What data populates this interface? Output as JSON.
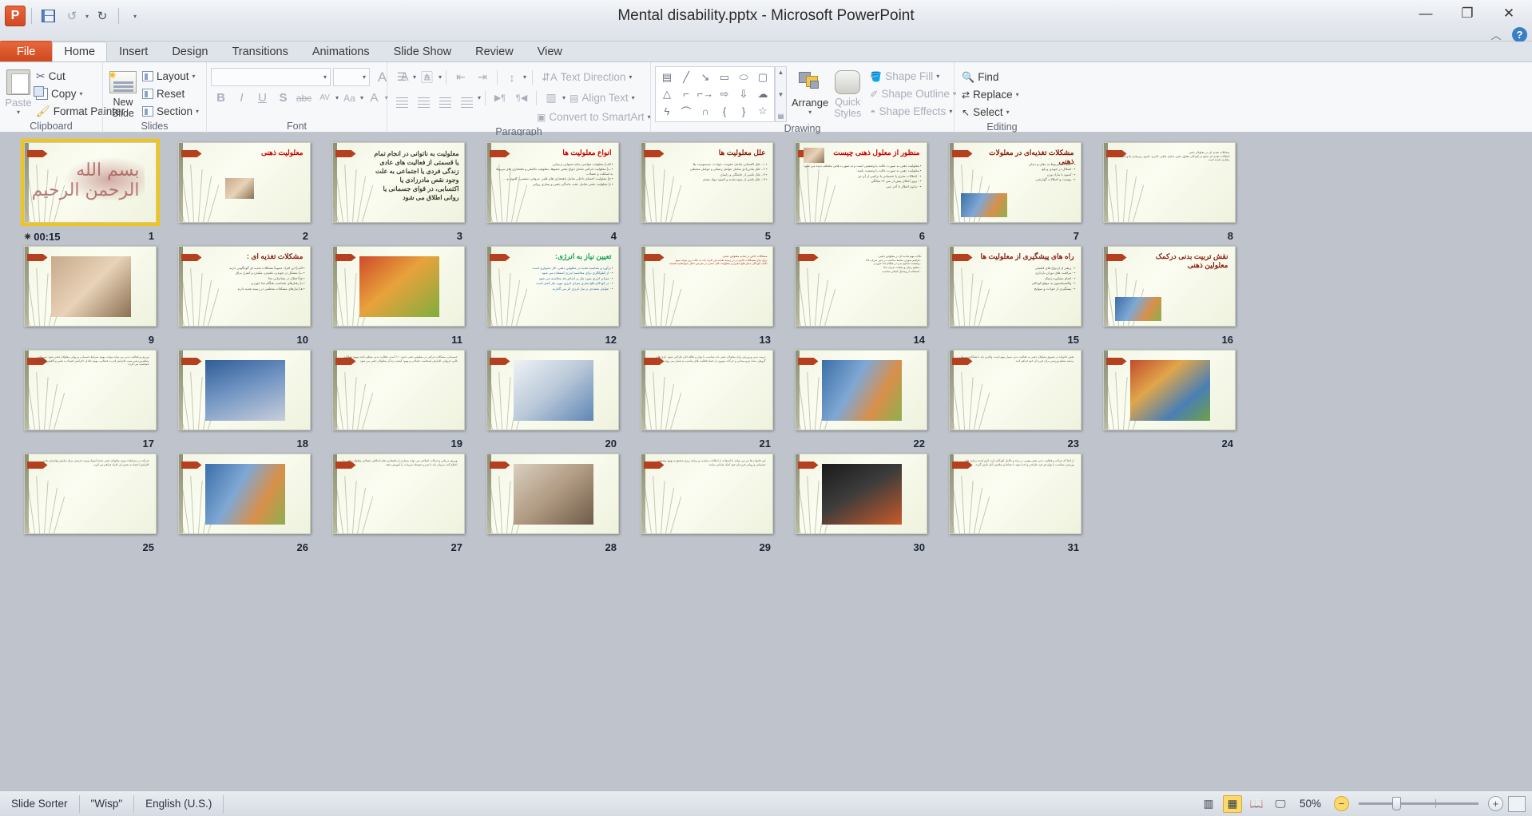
{
  "window": {
    "title": "Mental disability.pptx  -  Microsoft PowerPoint",
    "minimize": "—",
    "restore": "❐",
    "close": "✕",
    "collapse_ribbon": "︿",
    "help": "?"
  },
  "quick_access": {
    "app_icon": "P",
    "save": "save-icon",
    "undo": "↺",
    "undo_caret": "▾",
    "redo": "↻",
    "customize": "▾"
  },
  "tabs": [
    {
      "label": "File",
      "active": false,
      "file": true
    },
    {
      "label": "Home",
      "active": true
    },
    {
      "label": "Insert",
      "active": false
    },
    {
      "label": "Design",
      "active": false
    },
    {
      "label": "Transitions",
      "active": false
    },
    {
      "label": "Animations",
      "active": false
    },
    {
      "label": "Slide Show",
      "active": false
    },
    {
      "label": "Review",
      "active": false
    },
    {
      "label": "View",
      "active": false
    }
  ],
  "ribbon": {
    "clipboard": {
      "label": "Clipboard",
      "paste": "Paste",
      "paste_caret": "▾",
      "cut": "Cut",
      "copy": "Copy",
      "copy_caret": "▾",
      "format_painter": "Format Painter",
      "dialog_launcher": "⌐"
    },
    "slides": {
      "label": "Slides",
      "new_slide": "New",
      "new_slide_2": "Slide",
      "new_slide_caret": "▾",
      "layout": "Layout",
      "layout_caret": "▾",
      "reset": "Reset",
      "section": "Section",
      "section_caret": "▾"
    },
    "font": {
      "label": "Font",
      "font_name": "",
      "font_size": "",
      "grow": "A",
      "shrink": "A",
      "clear_formatting": "Aa",
      "bold": "B",
      "italic": "I",
      "underline": "U",
      "shadow": "S",
      "strikethrough": "abc",
      "spacing": "AV",
      "change_case": "Aa",
      "font_color": "A",
      "dialog_launcher": "⌐"
    },
    "paragraph": {
      "label": "Paragraph",
      "bullets": "bullets-icon",
      "numbering": "numbering-icon",
      "decrease_indent": "decrease-indent-icon",
      "increase_indent": "increase-indent-icon",
      "line_spacing": "line-spacing-icon",
      "align_left": "align-left-icon",
      "align_center": "align-center-icon",
      "align_right": "align-right-icon",
      "justify": "justify-icon",
      "ltr": "▶¶",
      "rtl": "¶◀",
      "columns": "columns-icon",
      "text_direction": "Text Direction",
      "align_text": "Align Text",
      "convert_smartart": "Convert to SmartArt",
      "dialog_launcher": "⌐"
    },
    "drawing": {
      "label": "Drawing",
      "shapes": [
        "text-box",
        "line",
        "arrow",
        "rectangle",
        "oval",
        "rounded-rectangle",
        "triangle",
        "elbow-connector",
        "elbow-arrow-connector",
        "right-arrow",
        "down-arrow",
        "cloud",
        "freeform",
        "arc",
        "curve",
        "left-brace",
        "right-brace",
        "star"
      ],
      "arrange": "Arrange",
      "arrange_caret": "▾",
      "quick_styles": "Quick",
      "quick_styles_2": "Styles",
      "quick_styles_caret": "▾",
      "shape_fill": "Shape Fill",
      "shape_outline": "Shape Outline",
      "shape_effects": "Shape Effects",
      "dialog_launcher": "⌐"
    },
    "editing": {
      "label": "Editing",
      "find": "Find",
      "replace": "Replace",
      "replace_caret": "▾",
      "select": "Select",
      "select_caret": "▾"
    }
  },
  "status": {
    "view_mode": "Slide Sorter",
    "theme": "\"Wisp\"",
    "language": "English (U.S.)",
    "zoom_level": "50%",
    "zoom_out": "−",
    "zoom_in": "+",
    "view_normal": "normal-view-icon",
    "view_sorter": "slide-sorter-icon",
    "view_reading": "reading-view-icon",
    "view_slideshow": "slideshow-icon",
    "fit_to_window": "fit-slide-to-window-icon"
  },
  "sorter": {
    "selected_slide": 1,
    "slides": [
      {
        "n": 1,
        "title": "",
        "kind": "bismillah",
        "timing": "00:15",
        "transition": "transition-star-icon",
        "selected": true,
        "body": []
      },
      {
        "n": 2,
        "title": "معلولیت ذهنی",
        "kind": "title-image",
        "titleColor": "red",
        "body": []
      },
      {
        "n": 3,
        "title": "",
        "kind": "text-only",
        "bigText": true,
        "body": [
          "معلولیت به ناتوانی در انجام تمام",
          "یا قسمتی از فعالیت های عادی",
          "زندگی فردی یا اجتماعی به علت",
          "وجود نقص مادرزادی یا",
          "اکتسابی، در قوای جسمانی یا",
          "روانی اطلاق می شود"
        ]
      },
      {
        "n": 4,
        "title": "انواع معلولیت ها",
        "kind": "bullets",
        "body": [
          "الف) معلولیت حواسی مانند شنوایی و بینایی",
          "ب) معلولیت حرکتی شامل انواع نقص عضوها، معلولیت تکاملی و ناهنجاری های مربوط به اسکلت و عضلات",
          "ج) معلولیت احشای داخلی شامل ناهنجاری های قلبی عروقی، تنفسی، کلیوی و ...",
          "د) معلولیت ذهنی شامل عقب ماندگی ذهنی و بیماری روانی"
        ]
      },
      {
        "n": 5,
        "title": "علل معلولیت ها",
        "kind": "bullets",
        "titleColor": "dark",
        "body": [
          "۱ ـ علل اکتسابی شامل عفونت، حوادث، مسمومیت ها",
          "۲ ـ علل مادرزادی شامل عوامل ژنتیکی و عوامل محیطی",
          "۳ ـ علل ناشی از حاملگی و زایمان",
          "۴ ـ علل ناشی از سوء تغذیه و کمبود مواد مغذی"
        ]
      },
      {
        "n": 6,
        "title": "منظور از معلول ذهنی چیست",
        "kind": "photo-text",
        "body": [
          "معلولیت ذهنی به صورت حالت یا وضعیتی است و به صورت هایی مختلف دیده می شود",
          "معلولیت ذهنی به صورت حالت یا وضعیت باشد:",
          "- اختلالات مغزی یا جسمانی یا ترکیبی از آن دو",
          "- بروز اختلال پیش از سن ۲۲ سالگی",
          "- تداوم اختلال تا آخر عمر"
        ]
      },
      {
        "n": 7,
        "title": "مشکلات تغذیه‌ای در معلولات ذهنی",
        "kind": "bullets-photo",
        "titleColor": "dark",
        "body": [
          "- اختلالات مربوط به دهان و دندان",
          "- اشکال در جویدن و بلع",
          "- کمبود یا مازاد وزن",
          "- یبوست و اختلالات گوارشی"
        ]
      },
      {
        "n": 8,
        "title": "",
        "kind": "text-only",
        "body": [
          "مشکلات تغذیه ای در معلولان ذهنی",
          "اختلالات تغذیه ای شایع در کودکان معلول ذهنی شامل چاقی، لاغری، کمبود ریزمغذی ها و اختلالات رفتاری تغذیه است"
        ]
      },
      {
        "n": 9,
        "title": "",
        "kind": "photo-only",
        "phClass": "kid",
        "body": []
      },
      {
        "n": 10,
        "title": "مشکلات تغذیه ای :",
        "kind": "bullets",
        "titleColor": "dark",
        "body": [
          "الف) این افراد عموماً مشکلات تغذیه ای گوناگونی دارند",
          "ب) مشکل در جویدن، بلعیدن، مکیدن و کنترل بزاق",
          "ج) اختلال در شناسایی غذا",
          "د) رفتارهای نامناسب هنگام غذا خوردن",
          "هـ) نیازهای مشکلات مختلفی در زمینه تغذیه دارند"
        ]
      },
      {
        "n": 11,
        "title": "",
        "kind": "photo-only",
        "phClass": "food",
        "body": []
      },
      {
        "n": 12,
        "title": "تعیین نیاز به انرژی:",
        "kind": "bullets",
        "titleColor": "green",
        "bodyColor": "blue",
        "body": [
          "برآورد و محاسبه تغذیه در معلولین ذهنی، کار دشواری است",
          "- از کیلوکالری برای محاسبه انرژی استفاده می شود",
          "- میزان انرژی مورد نیاز بر اساس قد محاسبه می شود",
          "- در کودکان فلج مغزی میزان انرژی مورد نیاز کمتر است",
          "- عوامل متعددی بر نیاز انرژی اثر می گذارند"
        ]
      },
      {
        "n": 13,
        "title": "",
        "kind": "text-only",
        "bodyColor": "red",
        "body": [
          "مشکلات خاص در تغذیه معلولین ذهنی:",
          "برای بیان مشکلات خاص تر در زمینه تغذیه این افراد باید به نکات زیر توجه نمود",
          "اغلب کودکان دچار فلج مغزی و معلولیت های ذهنی در معرض خطر سوءتغذیه هستند"
        ]
      },
      {
        "n": 14,
        "title": "",
        "kind": "text-only",
        "body": [
          "نکات مهم تغذیه ای در معلولین ذهنی:",
          "- فراهم نمودن محیط مناسب در حین صرف غذا",
          "- وضعیت صحیح بدن در هنگام غذا خوردن",
          "- تنظیم زمان و دفعات صرف غذا",
          "- استفاده از وسایل کمکی مناسب"
        ]
      },
      {
        "n": 15,
        "title": "راه های پیشگیری از معلولیت ها",
        "kind": "bullets",
        "titleColor": "dark",
        "body": [
          "- پرهیز از ازدواج های فامیلی",
          "- مراقبت های دوران بارداری",
          "- انجام مشاوره ژنتیک",
          "- واکسیناسیون به موقع کودکان",
          "- پیشگیری از حوادث و سوانح"
        ]
      },
      {
        "n": 16,
        "title": "نقش تربیت بدنی درکمک  معلولین ذهنی",
        "kind": "bullets-photo",
        "titleColor": "dark",
        "body": []
      },
      {
        "n": 17,
        "title": "",
        "kind": "full-text",
        "body": [
          "ورزش و فعالیت بدنی می تواند موجب بهبود شرایط جسمانی و روانی معلولان ذهنی شود. تمرینات منظم ورزشی سبب افزایش قدرت عضلانی، بهبود تعادل، افزایش اعتماد به نفس و کاهش رفتارهای نامناسب می گردد."
        ]
      },
      {
        "n": 18,
        "title": "",
        "kind": "photo-only",
        "phClass": "gym",
        "body": []
      },
      {
        "n": 19,
        "title": "",
        "kind": "full-text",
        "bodyColor": "red",
        "body": [
          "جسمانی، مشکلات حرکتی در معلولین ذهنی حدود ۱۰٪ است. فعالیت بدنی منظم باعث بهبود عملکرد قلبی عروقی، افزایش استقامت عضلانی و بهبود کیفیت زندگی معلولان ذهنی می شود."
        ]
      },
      {
        "n": 20,
        "title": "",
        "kind": "photo-only",
        "phClass": "med",
        "body": []
      },
      {
        "n": 21,
        "title": "",
        "kind": "full-text",
        "body": [
          "تربیت بدنی و ورزش برای معلولان ذهنی باید متناسب با توان و علاقه آنان طراحی شود. بازی های گروهی، شنا، دو و میدانی و حرکات موزون از جمله فعالیت های مناسب به شمار می روند."
        ]
      },
      {
        "n": 22,
        "title": "",
        "kind": "photo-only",
        "phClass": "people",
        "body": []
      },
      {
        "n": 23,
        "title": "",
        "kind": "full-text",
        "bodyColor": "blue",
        "body": [
          "نقش خانواده در تشویق معلولان ذهنی به فعالیت بدنی بسیار مهم است. والدین باید با همکاری مربیان برنامه منظم ورزشی برای فرزندان خود فراهم کنند."
        ]
      },
      {
        "n": 24,
        "title": "",
        "kind": "photo-only",
        "phClass": "mixed",
        "body": []
      },
      {
        "n": 25,
        "title": "",
        "kind": "full-text",
        "body": [
          "شرکت در مسابقات ویژه معلولان ذهنی مانند المپیک ویژه، فرصتی برای نمایش توانمندی ها و افزایش اعتماد به نفس این افراد فراهم می آورد."
        ]
      },
      {
        "n": 26,
        "title": "",
        "kind": "photo-only",
        "phClass": "people",
        "body": []
      },
      {
        "n": 27,
        "title": "",
        "kind": "full-text",
        "body": [
          "ورزش درمانی و حرکات اصلاحی می تواند بسیاری از ناهنجاری های اسکلتی عضلانی معلولان ذهنی را اصلاح کند. مربیان باید با صبر و حوصله تمرینات را آموزش دهند."
        ]
      },
      {
        "n": 28,
        "title": "",
        "kind": "photo-only",
        "phClass": "couch",
        "body": []
      },
      {
        "n": 29,
        "title": "",
        "kind": "full-text",
        "body": [
          "این خانواده ها نیز می توانند با استفاده از امکانات مناسب و برنامه ریزی صحیح به بهبود وضعیت جسمانی و روانی فرزندان خود کمک شایانی نمایند."
        ]
      },
      {
        "n": 30,
        "title": "",
        "kind": "photo-only",
        "phClass": "stage",
        "body": []
      },
      {
        "n": 31,
        "title": "",
        "kind": "full-text",
        "body": [
          "از آنجا که حرکت و فعالیت بدنی نقش مهمی در رشد و تکامل کودکان دارد، لازم است برنامه های ورزشی متناسب با توان هر فرد طراحی و اجرا شود تا نشاط و سلامتی آنان تأمین گردد."
        ]
      }
    ]
  }
}
